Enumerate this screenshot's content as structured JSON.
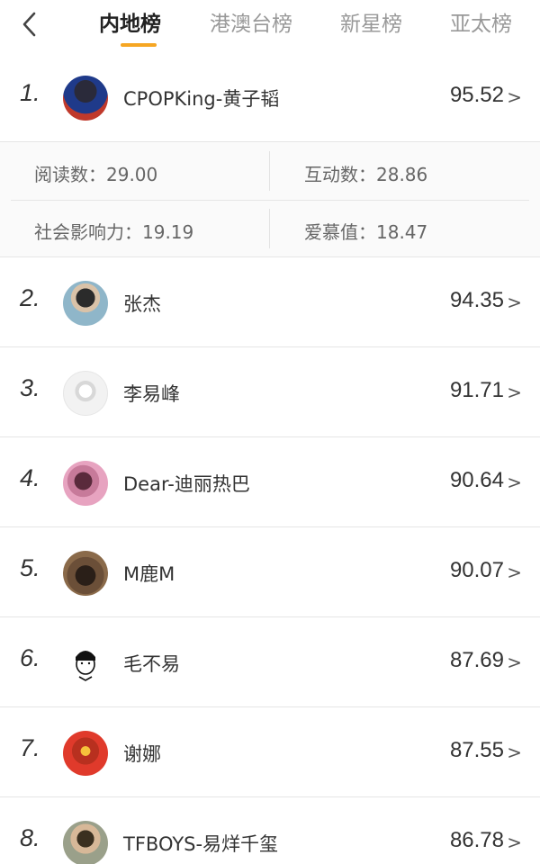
{
  "header": {
    "tabs": [
      {
        "label": "内地榜",
        "active": true
      },
      {
        "label": "港澳台榜",
        "active": false
      },
      {
        "label": "新星榜",
        "active": false
      },
      {
        "label": "亚太榜",
        "active": false
      }
    ],
    "accent_color": "#f6a623"
  },
  "list": [
    {
      "rank": "1.",
      "name": "CPOPKing-黄子韬",
      "score": "95.52",
      "avatar_colors": [
        "#1f3a8a",
        "#c0392b"
      ]
    },
    {
      "rank": "2.",
      "name": "张杰",
      "score": "94.35",
      "avatar_colors": [
        "#8fb6c9",
        "#2b2b2b"
      ]
    },
    {
      "rank": "3.",
      "name": "李易峰",
      "score": "91.71",
      "avatar_colors": [
        "#f2f2f2",
        "#bcbcbc"
      ]
    },
    {
      "rank": "4.",
      "name": "Dear-迪丽热巴",
      "score": "90.64",
      "avatar_colors": [
        "#e7a3c0",
        "#5a2a3c"
      ]
    },
    {
      "rank": "5.",
      "name": "M鹿M",
      "score": "90.07",
      "avatar_colors": [
        "#8a6a4a",
        "#2a1f18"
      ]
    },
    {
      "rank": "6.",
      "name": "毛不易",
      "score": "87.69",
      "avatar_colors": [
        "#ffffff",
        "#111111"
      ]
    },
    {
      "rank": "7.",
      "name": "谢娜",
      "score": "87.55",
      "avatar_colors": [
        "#e03a2b",
        "#f6c23b"
      ]
    },
    {
      "rank": "8.",
      "name": "TFBOYS-易烊千玺",
      "score": "86.78",
      "avatar_colors": [
        "#9aa08a",
        "#3b3020"
      ]
    }
  ],
  "details": {
    "reads": "阅读数：29.00",
    "interaction": "互动数：28.86",
    "influence": "社会影响力：19.19",
    "love": "爱慕值：18.47"
  },
  "icons": {
    "back": "chevron-left-icon",
    "row_arrow": "chevron-right-icon"
  }
}
